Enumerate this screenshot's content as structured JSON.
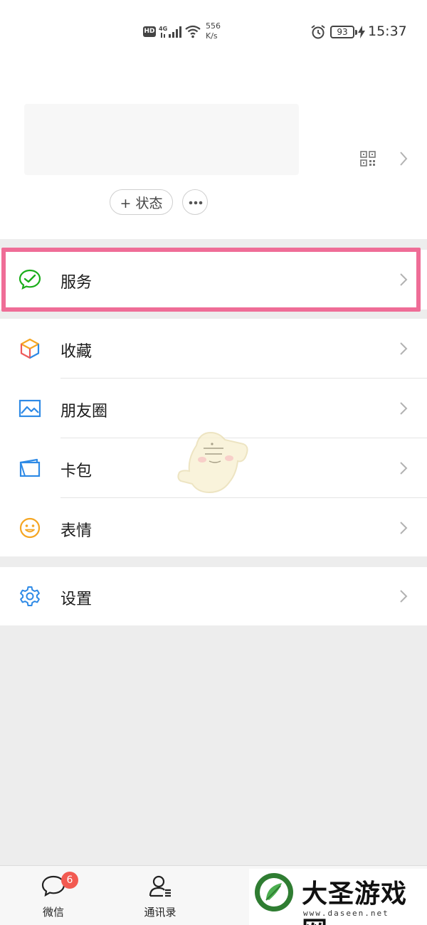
{
  "status_bar": {
    "hd": "HD",
    "network": "4G",
    "speed_value": "556",
    "speed_unit": "K/s",
    "battery": "93",
    "time": "15:37"
  },
  "profile": {
    "status_button_label": "+ 状态"
  },
  "menu": {
    "service": "服务",
    "favorites": "收藏",
    "moments": "朋友圈",
    "cards": "卡包",
    "stickers": "表情",
    "settings": "设置"
  },
  "bottom_nav": {
    "chats_label": "微信",
    "chats_badge": "6",
    "contacts_label": "通讯录"
  },
  "watermark": {
    "name": "大圣游戏网",
    "url": "www.daseen.net"
  },
  "colors": {
    "highlight_border": "#ef6d97",
    "wechat_green": "#07c160",
    "badge_red": "#f25a51"
  }
}
